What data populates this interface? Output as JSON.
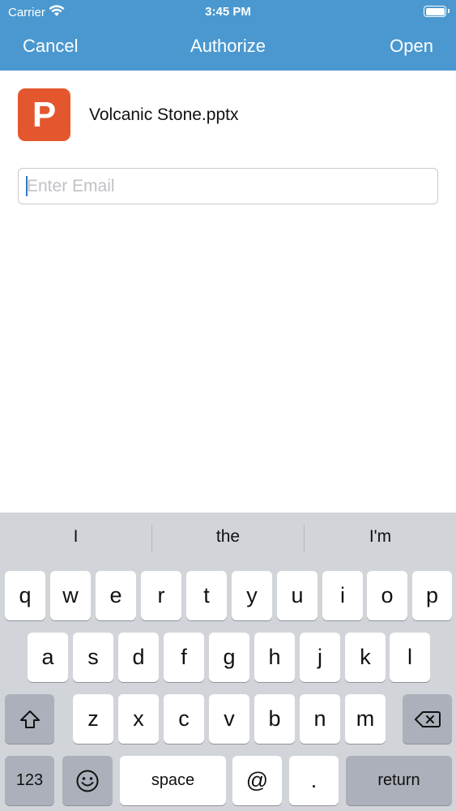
{
  "status_bar": {
    "carrier": "Carrier",
    "time": "3:45 PM"
  },
  "nav": {
    "cancel_label": "Cancel",
    "title": "Authorize",
    "open_label": "Open"
  },
  "file": {
    "icon_letter": "P",
    "name": "Volcanic Stone.pptx",
    "icon_color": "#e4572e"
  },
  "email_field": {
    "value": "",
    "placeholder": "Enter Email"
  },
  "keyboard": {
    "suggestions": [
      "I",
      "the",
      "I'm"
    ],
    "row1": [
      "q",
      "w",
      "e",
      "r",
      "t",
      "y",
      "u",
      "i",
      "o",
      "p"
    ],
    "row2": [
      "a",
      "s",
      "d",
      "f",
      "g",
      "h",
      "j",
      "k",
      "l"
    ],
    "row3": [
      "z",
      "x",
      "c",
      "v",
      "b",
      "n",
      "m"
    ],
    "numbers_label": "123",
    "space_label": "space",
    "at_label": "@",
    "period_label": ".",
    "return_label": "return"
  },
  "colors": {
    "header": "#4a98cf",
    "keyboard_bg": "#d1d4d9",
    "key_dark": "#abb0ba"
  }
}
